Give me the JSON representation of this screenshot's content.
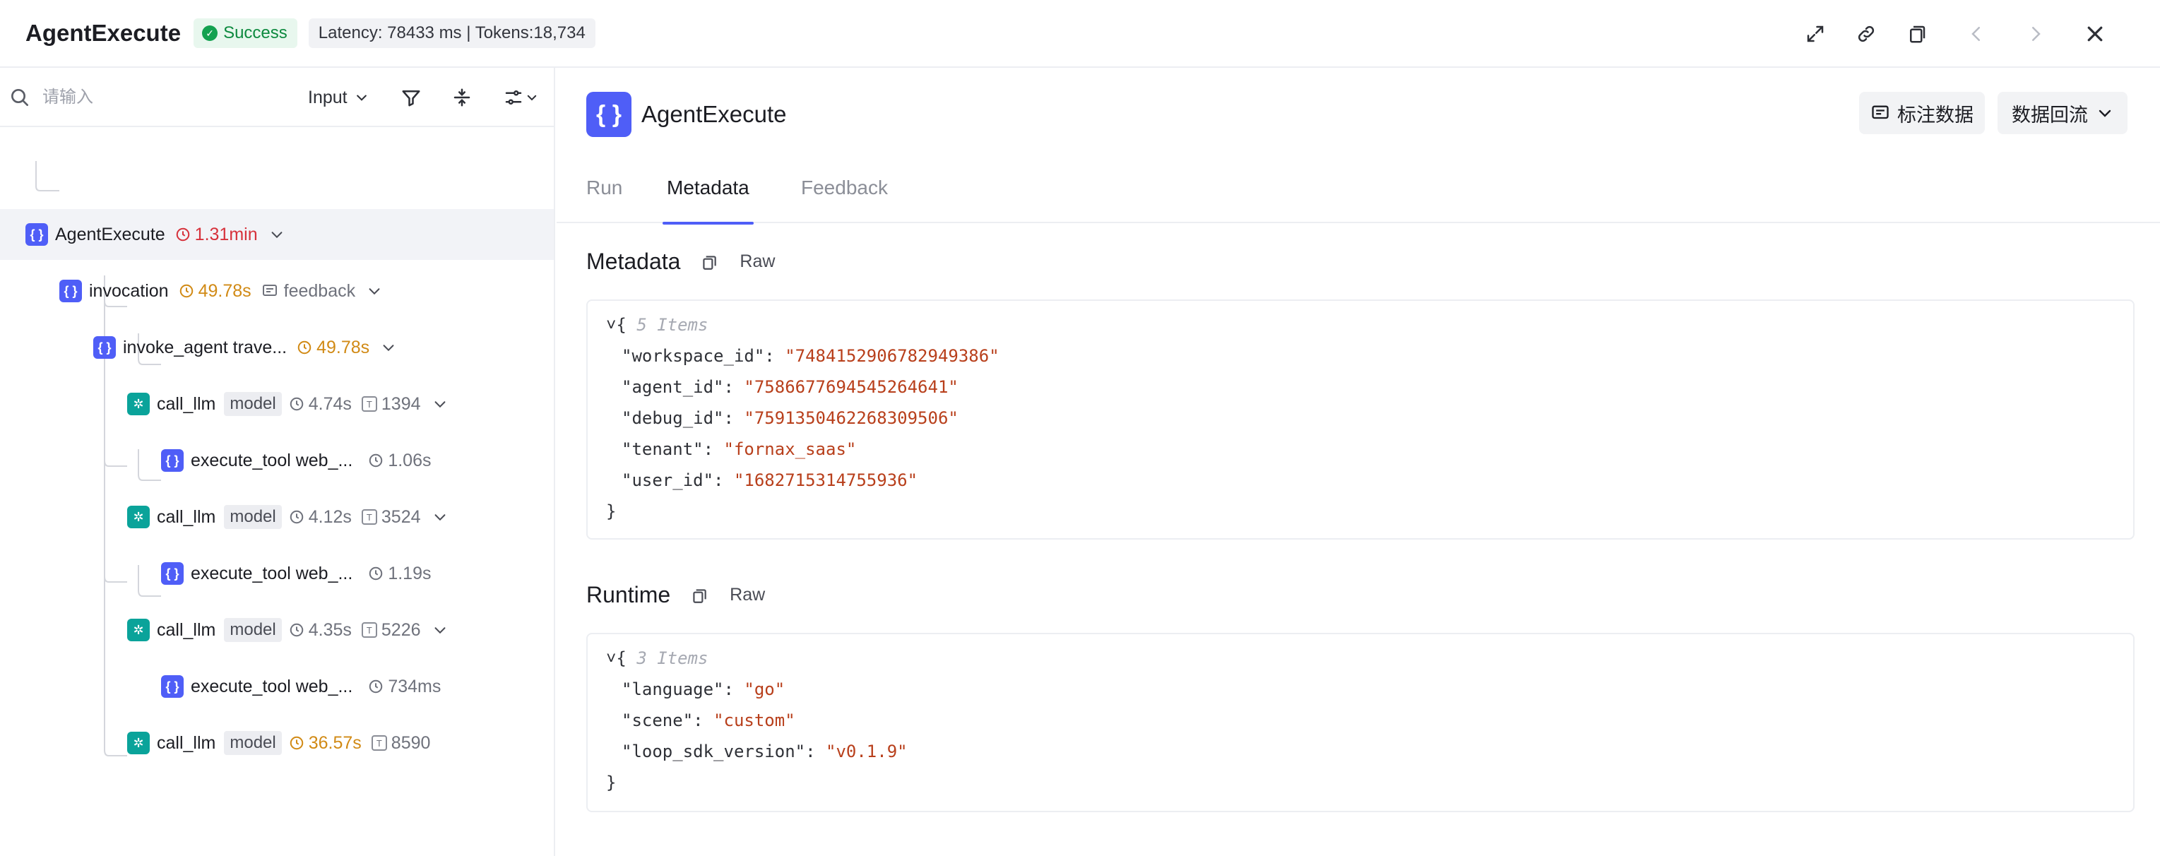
{
  "header": {
    "title": "AgentExecute",
    "status": "Success",
    "stats": "Latency: 78433 ms | Tokens:18,734"
  },
  "search": {
    "placeholder": "请输入",
    "filter_select": "Input"
  },
  "tree": [
    {
      "name": "AgentExecute",
      "type": "func",
      "duration": "1.31min",
      "duration_color": "red"
    },
    {
      "name": "invocation",
      "type": "func",
      "duration": "49.78s",
      "duration_color": "orange",
      "feedback": "feedback"
    },
    {
      "name": "invoke_agent trave...",
      "type": "func",
      "duration": "49.78s",
      "duration_color": "orange"
    },
    {
      "name": "call_llm",
      "type": "llm",
      "tag": "model",
      "duration": "4.74s",
      "duration_color": "gray",
      "tokens": "1394"
    },
    {
      "name": "execute_tool web_...",
      "type": "func",
      "duration": "1.06s",
      "duration_color": "gray"
    },
    {
      "name": "call_llm",
      "type": "llm",
      "tag": "model",
      "duration": "4.12s",
      "duration_color": "gray",
      "tokens": "3524"
    },
    {
      "name": "execute_tool web_...",
      "type": "func",
      "duration": "1.19s",
      "duration_color": "gray"
    },
    {
      "name": "call_llm",
      "type": "llm",
      "tag": "model",
      "duration": "4.35s",
      "duration_color": "gray",
      "tokens": "5226"
    },
    {
      "name": "execute_tool web_...",
      "type": "func",
      "duration": "734ms",
      "duration_color": "gray"
    },
    {
      "name": "call_llm",
      "type": "llm",
      "tag": "model",
      "duration": "36.57s",
      "duration_color": "orange",
      "tokens": "8590"
    }
  ],
  "detail": {
    "icon_text": "{ }",
    "title": "AgentExecute",
    "annotate_button": "标注数据",
    "backflow_button": "数据回流",
    "tabs": [
      "Run",
      "Metadata",
      "Feedback"
    ],
    "active_tab": "Metadata"
  },
  "metadata": {
    "title": "Metadata",
    "raw_label": "Raw",
    "count_label": "5 Items",
    "entries": [
      {
        "key": "\"workspace_id\"",
        "value": "\"7484152906782949386\""
      },
      {
        "key": "\"agent_id\"",
        "value": "\"7586677694545264641\""
      },
      {
        "key": "\"debug_id\"",
        "value": "\"7591350462268309506\""
      },
      {
        "key": "\"tenant\"",
        "value": "\"fornax_saas\""
      },
      {
        "key": "\"user_id\"",
        "value": "\"1682715314755936\""
      }
    ]
  },
  "runtime": {
    "title": "Runtime",
    "raw_label": "Raw",
    "count_label": "3 Items",
    "entries": [
      {
        "key": "\"language\"",
        "value": "\"go\""
      },
      {
        "key": "\"scene\"",
        "value": "\"custom\""
      },
      {
        "key": "\"loop_sdk_version\"",
        "value": "\"v0.1.9\""
      }
    ]
  },
  "colors": {
    "accent": "#4f5ef7",
    "llm": "#0aa39a",
    "success": "#14a150",
    "duration_red": "#d6313b",
    "duration_orange": "#d18a15",
    "json_string": "#b83f1b"
  }
}
